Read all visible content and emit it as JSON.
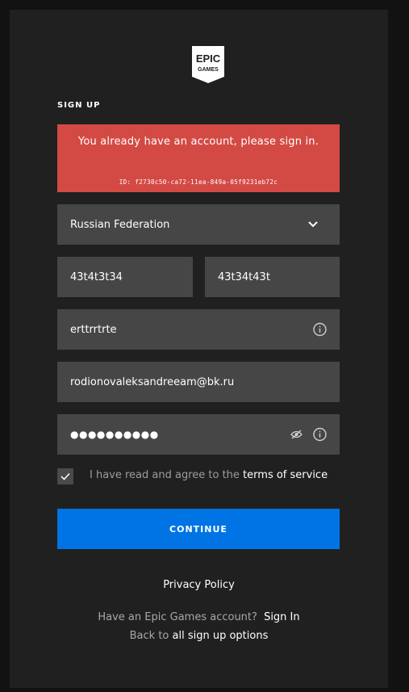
{
  "brand": {
    "logo_line1": "EPIC",
    "logo_line2": "GAMES"
  },
  "form": {
    "heading": "SIGN UP",
    "error": {
      "message": "You already have an account, please sign in.",
      "id_text": "ID: f2730c50-ca72-11ea-849a-05f9231eb72c"
    },
    "country": {
      "value": "Russian Federation",
      "icon": "chevron-down-icon"
    },
    "first_name": {
      "value": "43t4t3t34"
    },
    "last_name": {
      "value": "43t34t43t"
    },
    "display_name": {
      "value": "erttrrtrte",
      "icon": "info-icon"
    },
    "email": {
      "value": "rodionovaleksandreeam@bk.ru"
    },
    "password": {
      "value": "●●●●●●●●●●",
      "icons": [
        "eye-slash-icon",
        "info-icon"
      ]
    },
    "terms": {
      "checked": true,
      "prefix": "I have read and agree to the",
      "link": "terms of service"
    },
    "continue_label": "CONTINUE"
  },
  "footer": {
    "privacy_policy": "Privacy Policy",
    "have_account_prefix": "Have an Epic Games account?",
    "sign_in": "Sign In",
    "back_prefix": "Back to",
    "back_link": "all sign up options"
  },
  "colors": {
    "background": "#121212",
    "card": "#202020",
    "field": "#464646",
    "error": "#d34a44",
    "accent": "#0074e4"
  }
}
